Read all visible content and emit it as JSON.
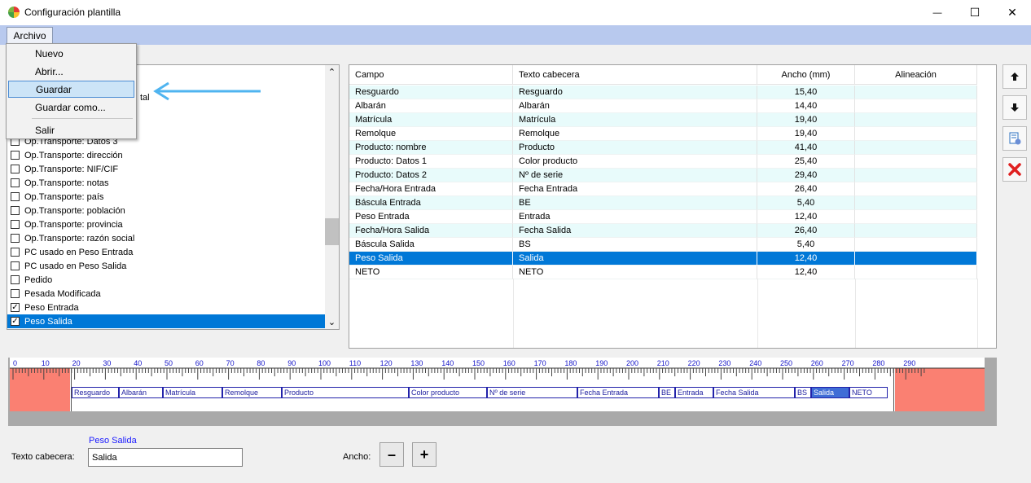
{
  "window": {
    "title": "Configuración plantilla",
    "minimize_glyph": "—",
    "maximize_glyph": "☐",
    "close_glyph": "✕"
  },
  "menubar": {
    "archivo": "Archivo"
  },
  "dropdown": {
    "items": [
      "Nuevo",
      "Abrir...",
      "Guardar",
      "Guardar como...",
      "Salir"
    ],
    "hovered": "Guardar"
  },
  "left_list": {
    "partial_text": "tal",
    "items": [
      {
        "label": "Op.Transporte: Datos 3",
        "checked": false
      },
      {
        "label": "Op.Transporte: dirección",
        "checked": false
      },
      {
        "label": "Op.Transporte: NIF/CIF",
        "checked": false
      },
      {
        "label": "Op.Transporte: notas",
        "checked": false
      },
      {
        "label": "Op.Transporte: país",
        "checked": false
      },
      {
        "label": "Op.Transporte: población",
        "checked": false
      },
      {
        "label": "Op.Transporte: provincia",
        "checked": false
      },
      {
        "label": "Op.Transporte: razón social",
        "checked": false
      },
      {
        "label": "PC usado en Peso Entrada",
        "checked": false
      },
      {
        "label": "PC usado en Peso Salida",
        "checked": false
      },
      {
        "label": "Pedido",
        "checked": false
      },
      {
        "label": "Pesada Modificada",
        "checked": false
      },
      {
        "label": "Peso Entrada",
        "checked": true
      },
      {
        "label": "Peso Salida",
        "checked": true
      }
    ],
    "selected": "Peso Salida",
    "check_glyph": "✓",
    "scroll_up": "⌃",
    "scroll_down": "⌄"
  },
  "table": {
    "headers": [
      "Campo",
      "Texto cabecera",
      "Ancho (mm)",
      "Alineación"
    ],
    "rows": [
      [
        "Resguardo",
        "Resguardo",
        "15,40",
        ""
      ],
      [
        "Albarán",
        "Albarán",
        "14,40",
        ""
      ],
      [
        "Matrícula",
        "Matrícula",
        "19,40",
        ""
      ],
      [
        "Remolque",
        "Remolque",
        "19,40",
        ""
      ],
      [
        "Producto: nombre",
        "Producto",
        "41,40",
        ""
      ],
      [
        "Producto: Datos 1",
        "Color producto",
        "25,40",
        ""
      ],
      [
        "Producto: Datos 2",
        "Nº de serie",
        "29,40",
        ""
      ],
      [
        "Fecha/Hora Entrada",
        "Fecha Entrada",
        "26,40",
        ""
      ],
      [
        "Báscula Entrada",
        "BE",
        "5,40",
        ""
      ],
      [
        "Peso Entrada",
        "Entrada",
        "12,40",
        ""
      ],
      [
        "Fecha/Hora Salida",
        "Fecha Salida",
        "26,40",
        ""
      ],
      [
        "Báscula Salida",
        "BS",
        "5,40",
        ""
      ],
      [
        "Peso Salida",
        "Salida",
        "12,40",
        ""
      ],
      [
        "NETO",
        "NETO",
        "12,40",
        ""
      ]
    ],
    "selected_row": 12
  },
  "side_buttons": [
    "arrow-up",
    "arrow-down",
    "edit-settings",
    "delete"
  ],
  "ruler": {
    "ticks": [
      0,
      10,
      20,
      30,
      40,
      50,
      60,
      70,
      80,
      90,
      100,
      110,
      120,
      130,
      140,
      150,
      160,
      170,
      180,
      190,
      200,
      210,
      220,
      230,
      240,
      250,
      260,
      270,
      280,
      290
    ],
    "fields": [
      "Resguardo",
      "Albarán",
      "Matrícula",
      "Remolque",
      "Producto",
      "Color producto",
      "Nº de serie",
      "Fecha Entrada",
      "BE",
      "Entrada",
      "Fecha Salida",
      "BS",
      "Salida",
      "NETO"
    ],
    "selected_field": "Salida"
  },
  "bottom": {
    "selected_field_name": "Peso Salida",
    "texto_cabecera_label": "Texto cabecera:",
    "texto_cabecera_value": "Salida",
    "ancho_label": "Ancho:",
    "minus": "–",
    "plus": "+"
  },
  "colors": {
    "menubar": "#b8c9ee",
    "selection": "#0078d7",
    "ruler_margin": "#fa8072",
    "row_alt": "#e8fbfb",
    "annotation_arrow": "#4fb4f0"
  }
}
